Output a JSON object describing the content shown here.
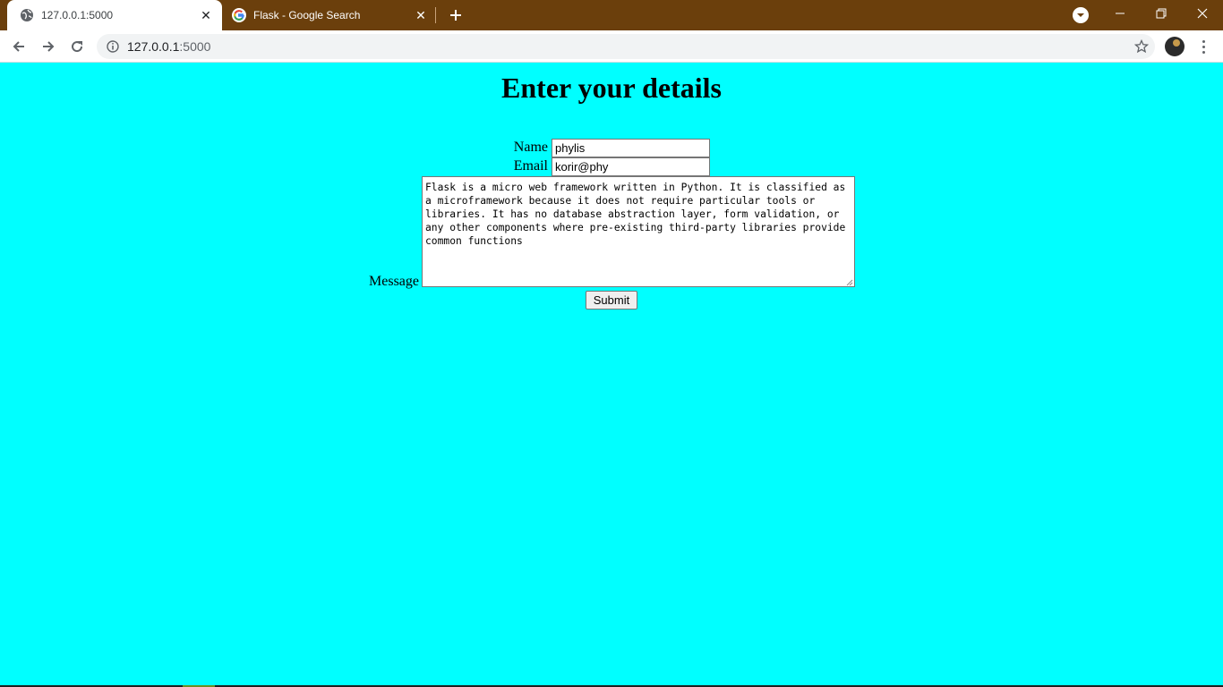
{
  "browser": {
    "tabs": [
      {
        "title": "127.0.0.1:5000",
        "active": true,
        "favicon": "globe-icon"
      },
      {
        "title": "Flask - Google Search",
        "active": false,
        "favicon": "google-g-icon"
      }
    ],
    "address_bar": {
      "url_host": "127.0.0.1",
      "url_port": ":5000"
    },
    "colors": {
      "tabstrip": "#6b3f0c",
      "page_background": "#00ffff"
    }
  },
  "page": {
    "heading": "Enter your details",
    "form": {
      "name_label": "Name",
      "name_value": "phylis",
      "email_label": "Email",
      "email_value": "korir@phy",
      "message_label": "Message",
      "message_value": "Flask is a micro web framework written in Python. It is classified as a microframework because it does not require particular tools or libraries. It has no database abstraction layer, form validation, or any other components where pre-existing third-party libraries provide common functions",
      "submit_label": "Submit"
    }
  }
}
